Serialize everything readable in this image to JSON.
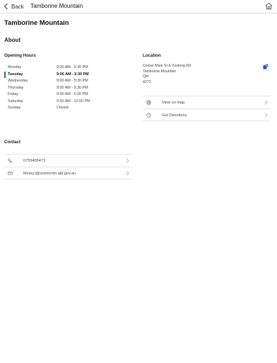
{
  "nav": {
    "back_label": "Back",
    "title": "Tamborine Mountain",
    "home_icon": "home-icon"
  },
  "page_title": "Tamborine Mountain",
  "about_heading": "About",
  "opening_hours": {
    "heading": "Opening Hours",
    "today_index": 1,
    "days": [
      {
        "day": "Monday",
        "time": "9:00 AM - 5:30 PM"
      },
      {
        "day": "Tuesday",
        "time": "9:00 AM - 5:30 PM"
      },
      {
        "day": "Wednesday",
        "time": "9:00 AM - 5:30 PM"
      },
      {
        "day": "Thursday",
        "time": "9:00 AM - 5:30 PM"
      },
      {
        "day": "Friday",
        "time": "9:00 AM - 5:30 PM"
      },
      {
        "day": "Saturday",
        "time": "9:00 AM - 12:00 PM"
      },
      {
        "day": "Sunday",
        "time": "Closed"
      }
    ]
  },
  "location": {
    "heading": "Location",
    "address_lines": [
      "Corner Main St & Yuulong Rd",
      "Tamborine Mountain",
      "Qld",
      "4272"
    ],
    "pin_icon": "map-pin-icon",
    "actions": [
      {
        "label": "View on map",
        "icon": "globe-icon"
      },
      {
        "label": "Get Directions",
        "icon": "compass-icon"
      }
    ]
  },
  "contact": {
    "heading": "Contact",
    "items": [
      {
        "label": "0755405473",
        "icon": "phone-icon"
      },
      {
        "label": "library.t@scenicrim.qld.gov.au",
        "icon": "mail-icon"
      }
    ]
  },
  "colors": {
    "today_marker": "#2e7d32",
    "map_pin": "#2457a6",
    "divider": "#e6e6e6"
  }
}
